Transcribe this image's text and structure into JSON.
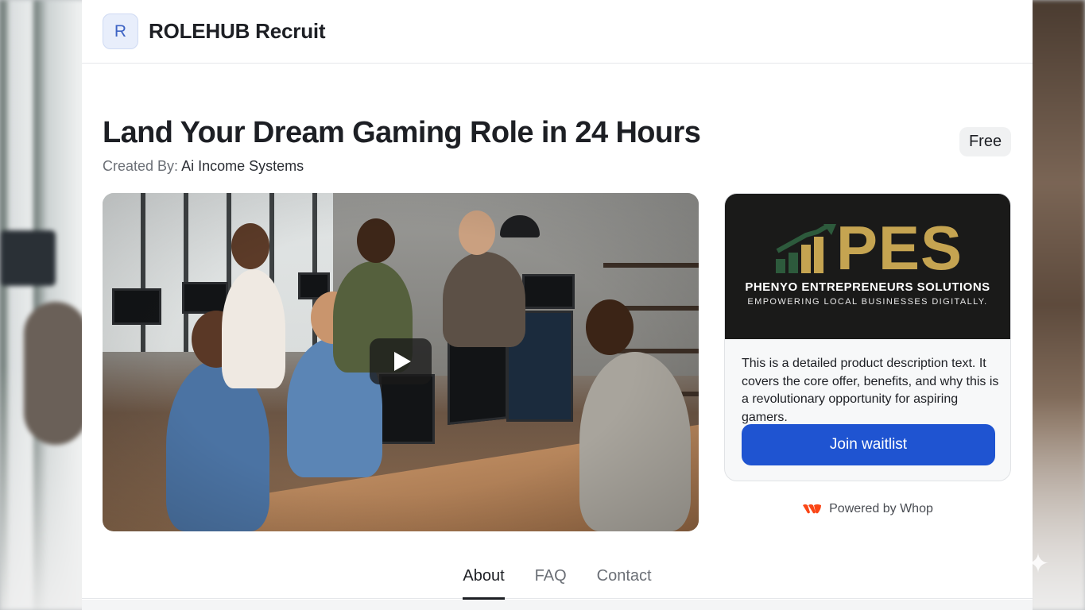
{
  "app": {
    "avatar_letter": "R",
    "brand": "ROLEHUB Recruit"
  },
  "product": {
    "title": "Land Your Dream Gaming Role in 24 Hours",
    "created_by_label": "Created By:",
    "creator": "Ai Income Systems",
    "price": "Free"
  },
  "video": {
    "play_icon": "play-icon"
  },
  "card": {
    "logo_big": "PES",
    "logo_line1": "PHENYO ENTREPRENEURS SOLUTIONS",
    "logo_line2": "EMPOWERING LOCAL BUSINESSES DIGITALLY.",
    "description": "This is a detailed product description text. It covers the core offer, benefits, and why this is a revolutionary opportunity for aspiring gamers.",
    "cta": "Join waitlist"
  },
  "powered_by": "Powered by Whop",
  "tabs": [
    {
      "label": "About",
      "active": true
    },
    {
      "label": "FAQ",
      "active": false
    },
    {
      "label": "Contact",
      "active": false
    }
  ],
  "colors": {
    "accent": "#1f54d1",
    "logo_gold": "#c5a451",
    "logo_green": "#2d5a3c",
    "whop_orange": "#fa4616"
  }
}
